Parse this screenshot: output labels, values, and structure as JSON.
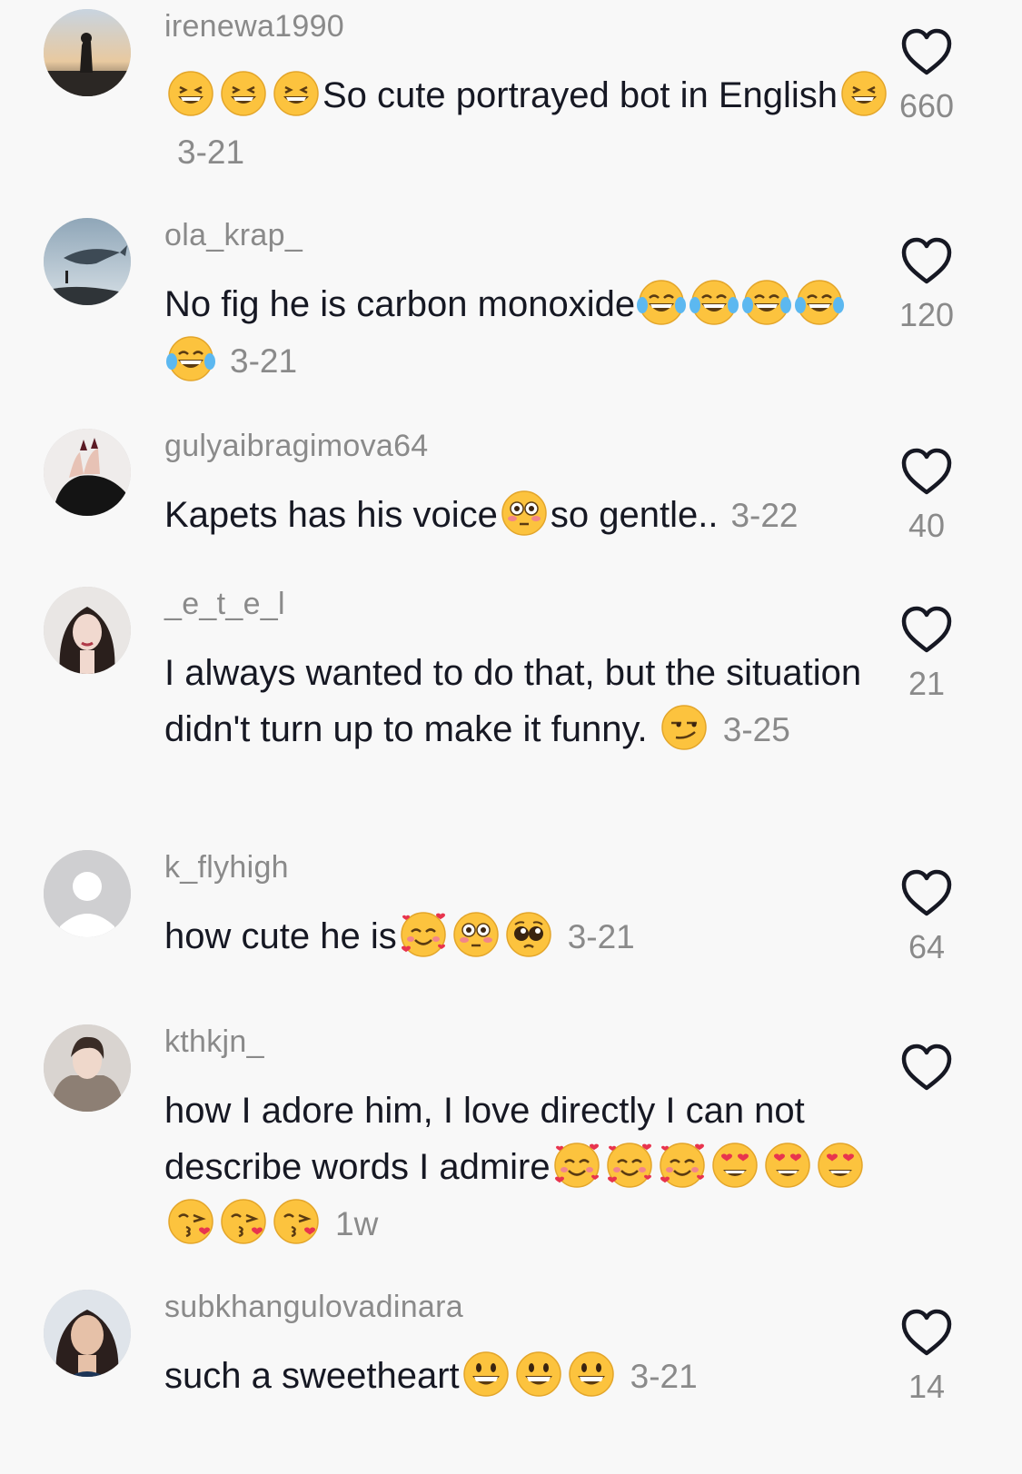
{
  "colors": {
    "background": "#f8f8f8",
    "text": "#161823",
    "muted": "#8a8a8a",
    "emoji_face": "#fcc33e"
  },
  "comments": [
    {
      "username": "irenewa1990",
      "likes": "660",
      "date": "3-21",
      "avatar": "sunset-silhouette",
      "body": [
        {
          "e": "grinning-squinting-face-emoji"
        },
        {
          "e": "grinning-squinting-face-emoji"
        },
        {
          "e": "grinning-squinting-face-emoji"
        },
        {
          "t": "So cute portrayed bot in English"
        },
        {
          "e": "grinning-squinting-face-emoji"
        }
      ]
    },
    {
      "username": "ola_krap_",
      "likes": "120",
      "date": "3-21",
      "avatar": "whale-sky",
      "body": [
        {
          "t": "No fig he is carbon monoxide"
        },
        {
          "e": "tears-of-joy-emoji"
        },
        {
          "e": "tears-of-joy-emoji"
        },
        {
          "e": "tears-of-joy-emoji"
        },
        {
          "e": "tears-of-joy-emoji"
        },
        {
          "e": "tears-of-joy-emoji"
        }
      ]
    },
    {
      "username": "gulyaibragimova64",
      "likes": "40",
      "date": "3-22",
      "avatar": "dark-nails",
      "body": [
        {
          "t": "Kapets has his voice"
        },
        {
          "e": "flushed-face-emoji"
        },
        {
          "t": "so gentle.."
        }
      ]
    },
    {
      "username": "_e_t_e_l",
      "likes": "21",
      "date": "3-25",
      "avatar": "girl-portrait",
      "body": [
        {
          "t": "I always wanted to do that, but the situation didn't turn up to make it funny. "
        },
        {
          "e": "smirking-face-emoji"
        }
      ]
    },
    {
      "username": "k_flyhigh",
      "likes": "64",
      "date": "3-21",
      "avatar": "default-user",
      "body": [
        {
          "t": "how cute he is"
        },
        {
          "e": "smiling-face-with-hearts-emoji"
        },
        {
          "e": "flushed-face-emoji"
        },
        {
          "e": "pleading-face-emoji"
        }
      ]
    },
    {
      "username": "kthkjn_",
      "likes": "",
      "date": "1w",
      "avatar": "fur-portrait",
      "body": [
        {
          "t": "how I adore him, I love directly I can not describe words I admire"
        },
        {
          "e": "smiling-face-with-hearts-emoji"
        },
        {
          "e": "smiling-face-with-hearts-emoji"
        },
        {
          "e": "smiling-face-with-hearts-emoji"
        },
        {
          "e": "heart-eyes-emoji"
        },
        {
          "e": "heart-eyes-emoji"
        },
        {
          "e": "heart-eyes-emoji"
        },
        {
          "e": "face-blowing-kiss-emoji"
        },
        {
          "e": "face-blowing-kiss-emoji"
        },
        {
          "e": "face-blowing-kiss-emoji"
        }
      ]
    },
    {
      "username": "subkhangulovadinara",
      "likes": "14",
      "date": "3-21",
      "avatar": "woman-portrait",
      "body": [
        {
          "t": "such a sweetheart"
        },
        {
          "e": "grinning-face-emoji"
        },
        {
          "e": "grinning-face-emoji"
        },
        {
          "e": "grinning-face-emoji"
        }
      ]
    }
  ]
}
